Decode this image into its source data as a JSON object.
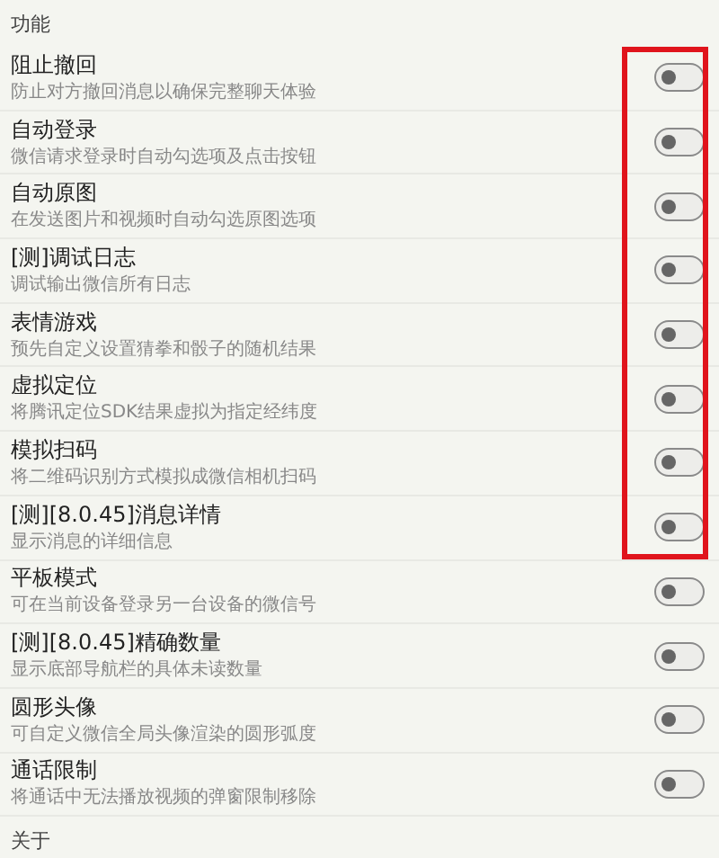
{
  "section_title": "功能",
  "items": [
    {
      "title": "阻止撤回",
      "description": "防止对方撤回消息以确保完整聊天体验",
      "on": false,
      "highlighted": true
    },
    {
      "title": "自动登录",
      "description": "微信请求登录时自动勾选项及点击按钮",
      "on": false,
      "highlighted": true
    },
    {
      "title": "自动原图",
      "description": "在发送图片和视频时自动勾选原图选项",
      "on": false,
      "highlighted": true
    },
    {
      "title": "[测]调试日志",
      "description": "调试输出微信所有日志",
      "on": false,
      "highlighted": true
    },
    {
      "title": "表情游戏",
      "description": "预先自定义设置猜拳和骰子的随机结果",
      "on": false,
      "highlighted": true
    },
    {
      "title": "虚拟定位",
      "description": "将腾讯定位SDK结果虚拟为指定经纬度",
      "on": false,
      "highlighted": true
    },
    {
      "title": "模拟扫码",
      "description": "将二维码识别方式模拟成微信相机扫码",
      "on": false,
      "highlighted": true
    },
    {
      "title": "[测][8.0.45]消息详情",
      "description": "显示消息的详细信息",
      "on": false,
      "highlighted": true
    },
    {
      "title": "平板模式",
      "description": "可在当前设备登录另一台设备的微信号",
      "on": false,
      "highlighted": false
    },
    {
      "title": "[测][8.0.45]精确数量",
      "description": "显示底部导航栏的具体未读数量",
      "on": false,
      "highlighted": false
    },
    {
      "title": "圆形头像",
      "description": "可自定义微信全局头像渲染的圆形弧度",
      "on": false,
      "highlighted": false
    },
    {
      "title": "通话限制",
      "description": "将通话中无法播放视频的弹窗限制移除",
      "on": false,
      "highlighted": false
    }
  ],
  "next_section_title": "关于"
}
